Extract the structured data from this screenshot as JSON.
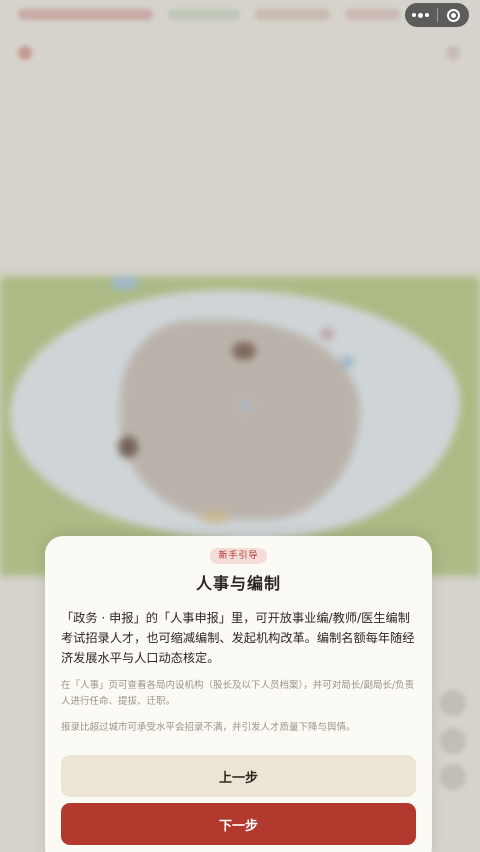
{
  "guide": {
    "badge": "新手引导",
    "title": "人事与编制",
    "main_text": "「政务 · 申报」的「人事申报」里，可开放事业编/教师/医生编制考试招录人才，也可缩减编制、发起机构改革。编制名额每年随经济发展水平与人口动态核定。",
    "note1": "在「人事」页可查看各局内设机构（股长及以下人员档案），并可对局长/副局长/负责人进行任命、提拔、迁职。",
    "note2": "报录比超过城市可承受水平会招录不满，并引发人才质量下降与舆情。",
    "prev_label": "上一步",
    "next_label": "下一步"
  },
  "capsule": {
    "more_icon": "more-dots-icon",
    "close_icon": "target-circle-icon"
  },
  "colors": {
    "accent": "#b1392d",
    "card_bg": "#fcfaf4",
    "secondary_button": "#ece5d3",
    "badge_bg": "#f5dcd8"
  }
}
